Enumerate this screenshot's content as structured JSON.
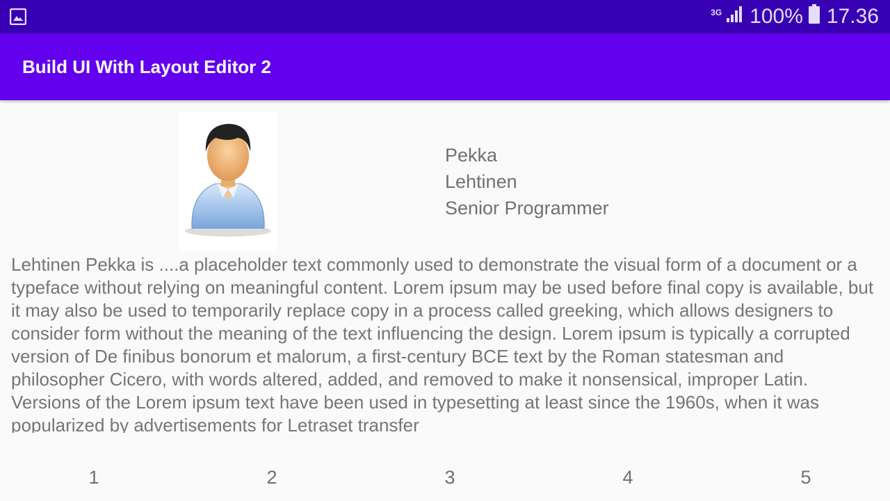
{
  "status_bar": {
    "left_icon": "gallery-icon",
    "network_type": "3G",
    "signal_icon": "signal-bars-icon",
    "battery_percent": "100%",
    "battery_icon": "battery-full-icon",
    "time": "17.36"
  },
  "app_bar": {
    "title": "Build UI With Layout Editor 2"
  },
  "profile": {
    "avatar_icon": "person-avatar-icon",
    "first_name": "Pekka",
    "last_name": "Lehtinen",
    "job_title": "Senior Programmer"
  },
  "bio": {
    "text": "Lehtinen Pekka is ....a placeholder text commonly used to demonstrate the visual form of a document or a typeface without relying on meaningful content. Lorem ipsum may be used before final copy is available, but it may also be used to temporarily replace copy in a process called greeking, which allows designers to consider form without the meaning of the text influencing the design. Lorem ipsum is typically a corrupted version of De finibus bonorum et malorum, a first-century BCE text by the Roman statesman and philosopher Cicero, with words altered, added, and removed to make it nonsensical, improper Latin. Versions of the Lorem ipsum text have been used in typesetting at least since the 1960s, when it was popularized by advertisements for Letraset transfer"
  },
  "bottom_numbers": [
    "1",
    "2",
    "3",
    "4",
    "5"
  ],
  "colors": {
    "status_bar": "#3700b3",
    "app_bar": "#6200ee",
    "background": "#fafafa",
    "text": "#757575"
  }
}
